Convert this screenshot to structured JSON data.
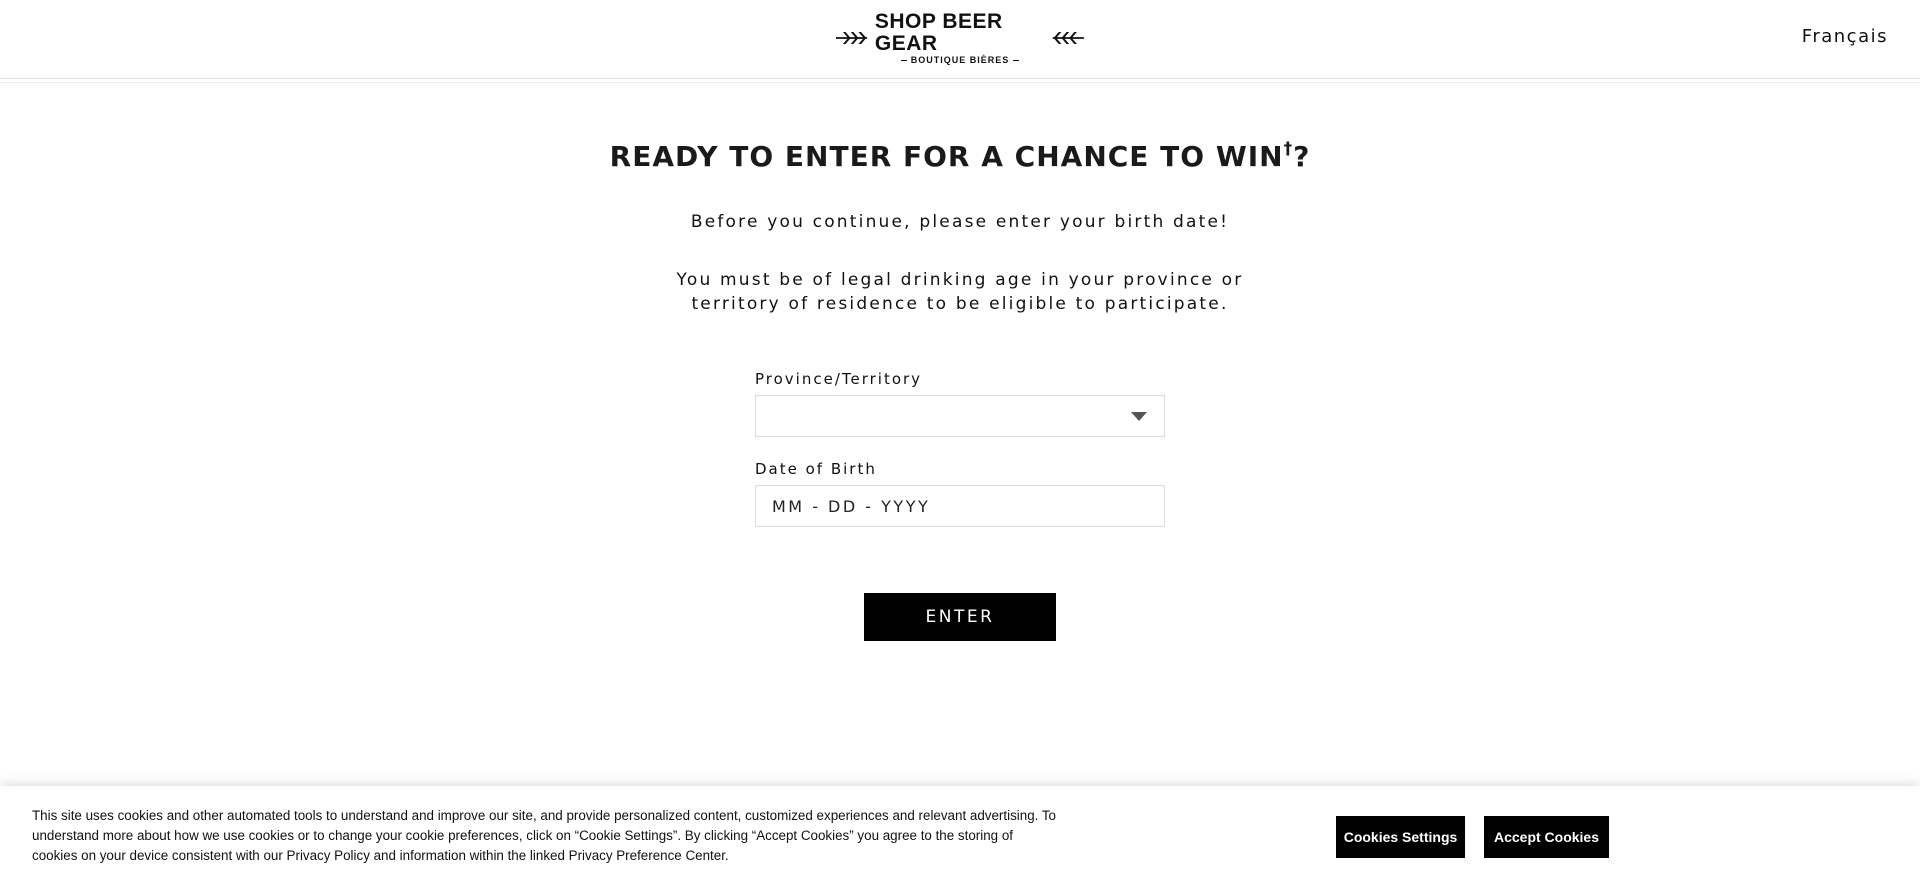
{
  "header": {
    "logo": {
      "main_text": "SHOP BEER GEAR",
      "sub_text": "BOUTIQUE BIÈRES"
    },
    "language_link": "Français"
  },
  "main": {
    "title": "READY TO ENTER FOR A CHANCE TO WIN",
    "title_mark": "†",
    "title_end": "?",
    "intro": "Before you continue, please enter your birth date!",
    "legal_line1": "You must be of legal drinking age in your province or",
    "legal_line2": "territory of residence to be eligible to participate.",
    "province": {
      "label": "Province/Territory",
      "value": ""
    },
    "dob": {
      "label": "Date of Birth",
      "placeholder": "MM - DD - YYYY"
    },
    "enter_label": "ENTER"
  },
  "cookies": {
    "text": "This site uses cookies and other automated tools to understand and improve our site, and provide personalized content, customized experiences and relevant advertising. To understand more about how we use cookies or to change your cookie preferences, click on “Cookie Settings”. By clicking “Accept Cookies” you agree to the storing of cookies on your device consistent with our Privacy Policy and information within the linked Privacy Preference Center.",
    "settings_label": "Cookies Settings",
    "accept_label": "Accept Cookies"
  }
}
